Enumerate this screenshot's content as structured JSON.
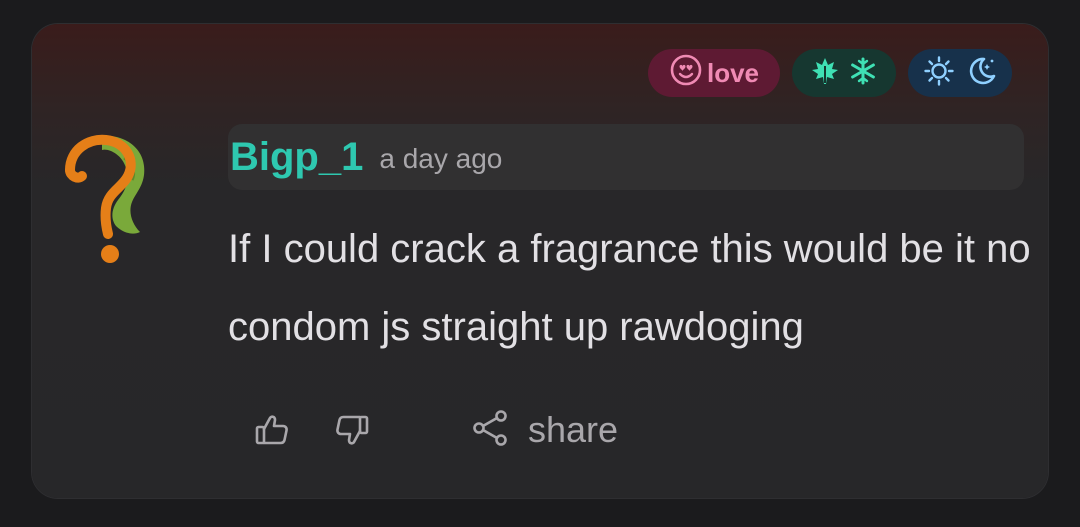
{
  "tags": {
    "love": {
      "label": "love",
      "icon": "heart-eyes-icon",
      "color": "#f08ab4"
    },
    "season": {
      "icons": [
        "maple-leaf-icon",
        "snowflake-icon"
      ],
      "color": "#3fe0b4"
    },
    "time": {
      "icons": [
        "sun-icon",
        "moon-stars-icon"
      ],
      "color": "#8fd0ff"
    }
  },
  "comment": {
    "author": "Bigp_1",
    "time": "a day ago",
    "text": "If I could crack a fragrance this would be it no condom js straight up rawdoging"
  },
  "actions": {
    "like_icon": "thumbs-up-icon",
    "dislike_icon": "thumbs-down-icon",
    "share_icon": "share-icon",
    "share_label": "share"
  },
  "colors": {
    "username": "#2ec8b0",
    "background": "#1b1b1d",
    "card": "#272729"
  }
}
